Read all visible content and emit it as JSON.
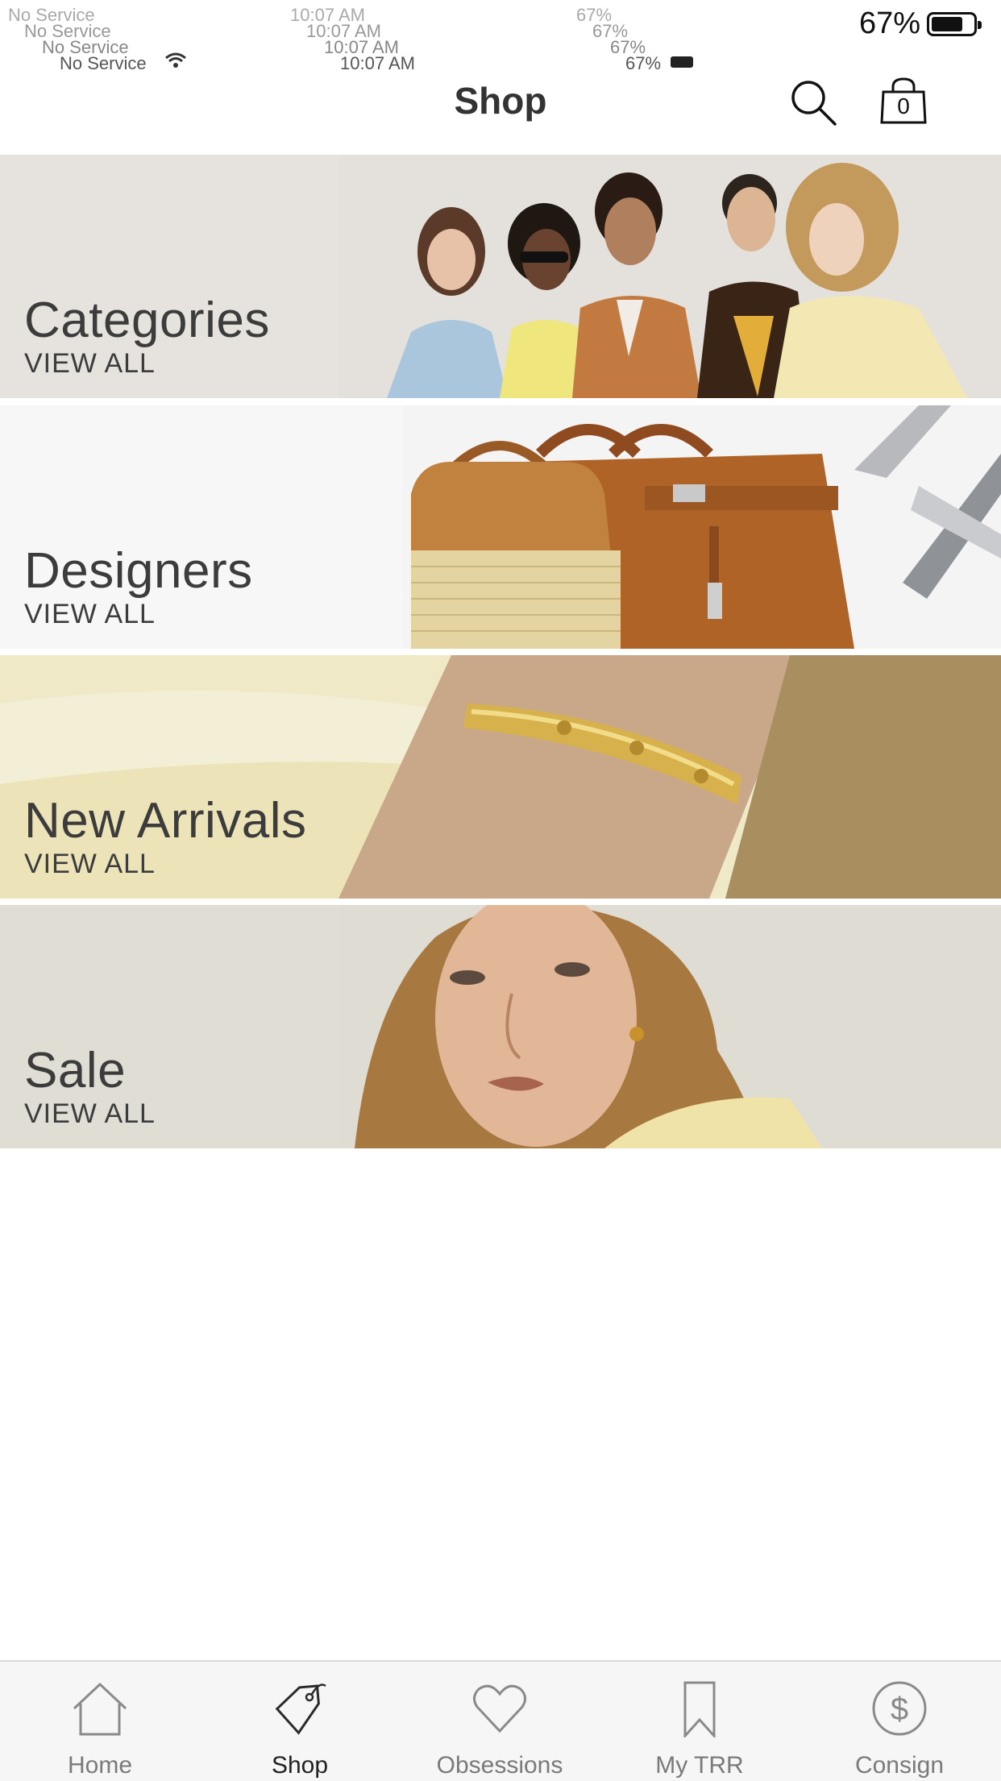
{
  "status_bar": {
    "carrier": "No Service",
    "time": "10:07 AM",
    "battery_small": "67%",
    "battery": "67%"
  },
  "header": {
    "title": "Shop",
    "search_icon": "search-icon",
    "bag_icon": "shopping-bag-icon",
    "bag_count": "0"
  },
  "banners": [
    {
      "title": "Categories",
      "subtitle": "VIEW ALL"
    },
    {
      "title": "Designers",
      "subtitle": "VIEW ALL"
    },
    {
      "title": "New Arrivals",
      "subtitle": "VIEW ALL"
    },
    {
      "title": "Sale",
      "subtitle": "VIEW ALL"
    }
  ],
  "tabbar": {
    "items": [
      {
        "label": "Home",
        "icon": "home-icon"
      },
      {
        "label": "Shop",
        "icon": "tag-icon",
        "active": true
      },
      {
        "label": "Obsessions",
        "icon": "heart-icon"
      },
      {
        "label": "My TRR",
        "icon": "bookmark-icon"
      },
      {
        "label": "Consign",
        "icon": "dollar-circle-icon"
      }
    ]
  }
}
